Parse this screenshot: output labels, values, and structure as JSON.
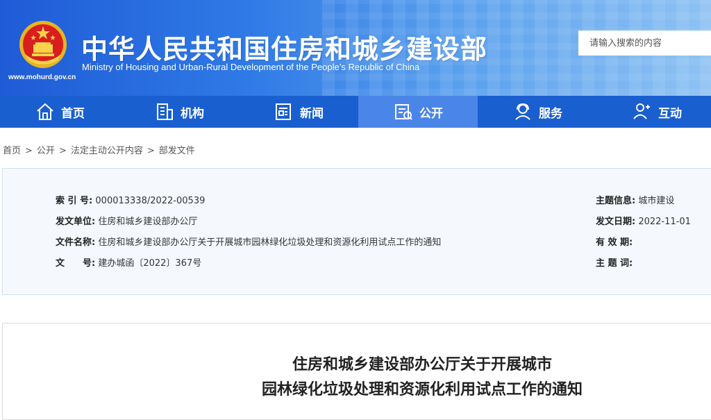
{
  "header": {
    "title": "中华人民共和国住房和城乡建设部",
    "subtitle": "Ministry of Housing and Urban-Rural Development of the People’s Republic of China",
    "url": "www.mohurd.gov.cn",
    "search_placeholder": "请输入搜索的内容"
  },
  "nav": {
    "items": [
      {
        "label": "首页",
        "icon": "home-icon"
      },
      {
        "label": "机构",
        "icon": "building-icon"
      },
      {
        "label": "新闻",
        "icon": "news-icon"
      },
      {
        "label": "公开",
        "icon": "open-info-icon",
        "active": true
      },
      {
        "label": "服务",
        "icon": "service-icon"
      },
      {
        "label": "互动",
        "icon": "interaction-icon"
      }
    ]
  },
  "breadcrumb": [
    "首页",
    "公开",
    "法定主动公开内容",
    "部发文件"
  ],
  "meta": {
    "index_label": "索 引 号:",
    "index_value": "000013338/2022-00539",
    "issuer_label": "发文单位:",
    "issuer_value": "住房和城乡建设部办公厅",
    "filename_label": "文件名称:",
    "filename_value": "住房和城乡建设部办公厅关于开展城市园林绿化垃圾处理和资源化利用试点工作的通知",
    "docno_label": "文　　号:",
    "docno_value": "建办城函〔2022〕367号",
    "topic_label": "主题信息:",
    "topic_value": "城市建设",
    "date_label": "发文日期:",
    "date_value": "2022-11-01",
    "validity_label": "有 效 期:",
    "validity_value": "",
    "keywords_label": "主 题 词:",
    "keywords_value": ""
  },
  "doc": {
    "title_line1": "住房和城乡建设部办公厅关于开展城市",
    "title_line2": "园林绿化垃圾处理和资源化利用试点工作的通知"
  },
  "colors": {
    "nav_bg": "#1a5fd0",
    "nav_active": "#4a86e8",
    "header_start": "#1f5bd6",
    "meta_bg": "#f5f9fd"
  }
}
